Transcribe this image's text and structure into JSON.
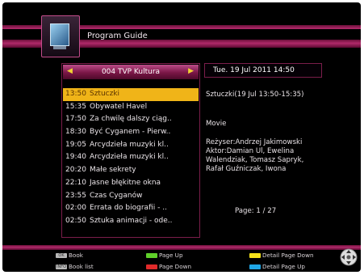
{
  "header": {
    "title": "Program Guide"
  },
  "channel": {
    "name": "004 TVP Kultura"
  },
  "datetime": "Tue.   19 Jul 2011 14:50",
  "programs": [
    {
      "time": "13:50",
      "title": "Sztuczki"
    },
    {
      "time": "15:35",
      "title": "Obywatel Havel"
    },
    {
      "time": "17:50",
      "title": "Za chwilę dalszy ciąg.."
    },
    {
      "time": "18:30",
      "title": "Być Cyganem - Pierw.."
    },
    {
      "time": "19:05",
      "title": "Arcydzieła muzyki kl.."
    },
    {
      "time": "19:40",
      "title": "Arcydzieła muzyki kl.."
    },
    {
      "time": "20:20",
      "title": "Małe sekrety"
    },
    {
      "time": "22:10",
      "title": "Jasne błękitne okna"
    },
    {
      "time": "23:55",
      "title": "Czas Cyganów"
    },
    {
      "time": "02:00",
      "title": "Errata do biografii - .."
    },
    {
      "time": "02:50",
      "title": "Sztuka animacji - ode.."
    }
  ],
  "detail": {
    "title_line": "Sztuczki(19 Jul 13:50-15:35)",
    "genre": "Movie",
    "description": "Reżyser:Andrzej Jakimowski Aktor:Damian Ul, Ewelina Walendziak, Tomasz Sapryk, Rafał Guźniczak, Iwona",
    "page": "Page:   1 / 27"
  },
  "footer": {
    "ok_label": "OK",
    "book": "Book",
    "info_label": "INFO",
    "book_list": "Book list",
    "page_up": "Page Up",
    "page_down": "Page Down",
    "detail_page_down": "Detail Page Down",
    "detail_page_up": "Detail Page Up"
  },
  "colors": {
    "accent": "#b02a6a",
    "selection": "#f0b418",
    "green": "#5fd02a",
    "red": "#e02a2a",
    "yellow": "#f5e21a",
    "blue": "#1fa6e6"
  }
}
